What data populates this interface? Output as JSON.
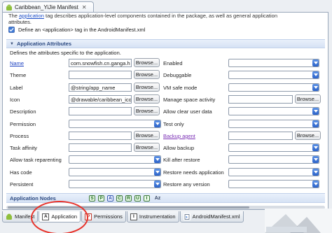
{
  "editor_tab": {
    "title": "Caribbean_YiJie Manifest",
    "close": "✕"
  },
  "top_text": {
    "line1_pre": "The",
    "line1_link": "application",
    "line1_post": "tag describes application-level components contained in the package, as well as general application",
    "line2": "attributes."
  },
  "define_application": {
    "label": "Define an <application> tag in the AndroidManifest.xml",
    "checked": true
  },
  "section": {
    "title": "Application Attributes",
    "description": "Defines the attributes specific to the application."
  },
  "left_attributes": [
    {
      "label": "Name",
      "style": "link",
      "value": "com.snowfish.cn.ganga.h",
      "browse": "Browse..."
    },
    {
      "label": "Theme",
      "style": "plain",
      "value": "",
      "browse": "Browse..."
    },
    {
      "label": "Label",
      "style": "plain",
      "value": "@string/app_name",
      "browse": "Browse..."
    },
    {
      "label": "Icon",
      "style": "plain",
      "value": "@drawable/caribbean_ico",
      "browse": "Browse..."
    },
    {
      "label": "Description",
      "style": "plain",
      "value": "",
      "browse": "Browse..."
    },
    {
      "label": "Permission",
      "style": "combo",
      "value": ""
    },
    {
      "label": "Process",
      "style": "plain",
      "value": "",
      "browse": "Browse..."
    },
    {
      "label": "Task affinity",
      "style": "plain",
      "value": "",
      "browse": "Browse..."
    },
    {
      "label": "Allow task reparenting",
      "style": "combo",
      "value": ""
    },
    {
      "label": "Has code",
      "style": "combo",
      "value": ""
    },
    {
      "label": "Persistent",
      "style": "combo",
      "value": ""
    }
  ],
  "right_attributes": [
    {
      "label": "Enabled",
      "style": "combo"
    },
    {
      "label": "Debuggable",
      "style": "combo"
    },
    {
      "label": "VM safe mode",
      "style": "combo"
    },
    {
      "label": "Manage space activity",
      "style": "plain",
      "browse": "Browse..."
    },
    {
      "label": "Allow clear user data",
      "style": "combo"
    },
    {
      "label": "Test only",
      "style": "combo"
    },
    {
      "label": "Backup agent",
      "style": "link",
      "browse": "Browse..."
    },
    {
      "label": "Allow backup",
      "style": "combo"
    },
    {
      "label": "Kill after restore",
      "style": "combo"
    },
    {
      "label": "Restore needs application",
      "style": "combo"
    },
    {
      "label": "Restore any version",
      "style": "combo"
    }
  ],
  "nodes": {
    "title": "Application Nodes",
    "buttons": [
      "S",
      "P",
      "A",
      "C",
      "R",
      "U",
      "I"
    ],
    "sort_label": "Az"
  },
  "bottom_tabs": [
    {
      "label": "Manifest",
      "icon": "android-icon"
    },
    {
      "label": "Application",
      "icon": "A",
      "active": true
    },
    {
      "label": "Permissions",
      "icon": "P"
    },
    {
      "label": "Instrumentation",
      "icon": "I"
    },
    {
      "label": "AndroidManifest.xml",
      "icon": "xml-icon"
    }
  ],
  "colors": {
    "annotation_circle": "#e8322a",
    "section_title": "#2c4a82",
    "link": "#1a3fc0"
  }
}
